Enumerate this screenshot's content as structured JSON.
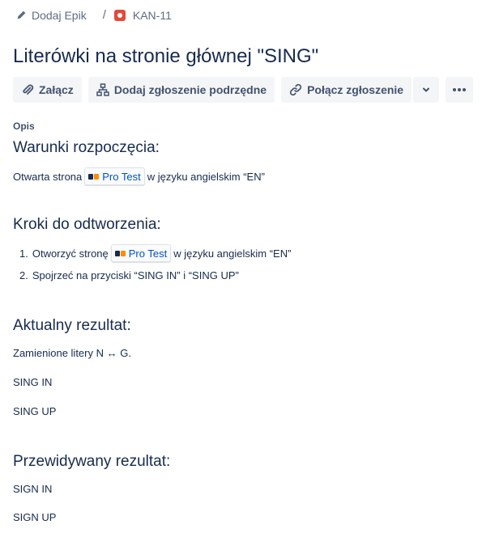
{
  "breadcrumb": {
    "epic_label": "Dodaj Epik",
    "separator": "/",
    "issue_key": "KAN-11"
  },
  "issue": {
    "title": "Literówki na stronie głównej \"SING\""
  },
  "toolbar": {
    "attach_label": "Załącz",
    "add_child_label": "Dodaj zgłoszenie podrzędne",
    "link_issue_label": "Połącz zgłoszenie"
  },
  "description": {
    "label": "Opis",
    "preconditions": {
      "heading": "Warunki rozpoczęcia:",
      "text_before": "Otwarta strona",
      "link_label": "Pro Test",
      "text_after": "w języku angielskim “EN”"
    },
    "steps": {
      "heading": "Kroki do odtworzenia:",
      "items": [
        {
          "num": "1.",
          "text_before": "Otworzyć stronę",
          "link_label": "Pro Test",
          "text_after": "w języku angielskim “EN”"
        },
        {
          "num": "2.",
          "text": "Spojrzeć na przyciski “SING IN” i “SING UP”"
        }
      ]
    },
    "actual": {
      "heading": "Aktualny rezultat:",
      "lines": [
        "Zamienione litery N ↔ G.",
        "SING IN",
        "SING UP"
      ]
    },
    "expected": {
      "heading": "Przewidywany rezultat:",
      "lines": [
        "SIGN IN",
        "SIGN UP"
      ]
    }
  },
  "colors": {
    "text": "#172b4d",
    "secondary_text": "#5e6c84",
    "button_bg": "#f4f5f7",
    "link": "#0052cc",
    "bug": "#e5493a"
  }
}
